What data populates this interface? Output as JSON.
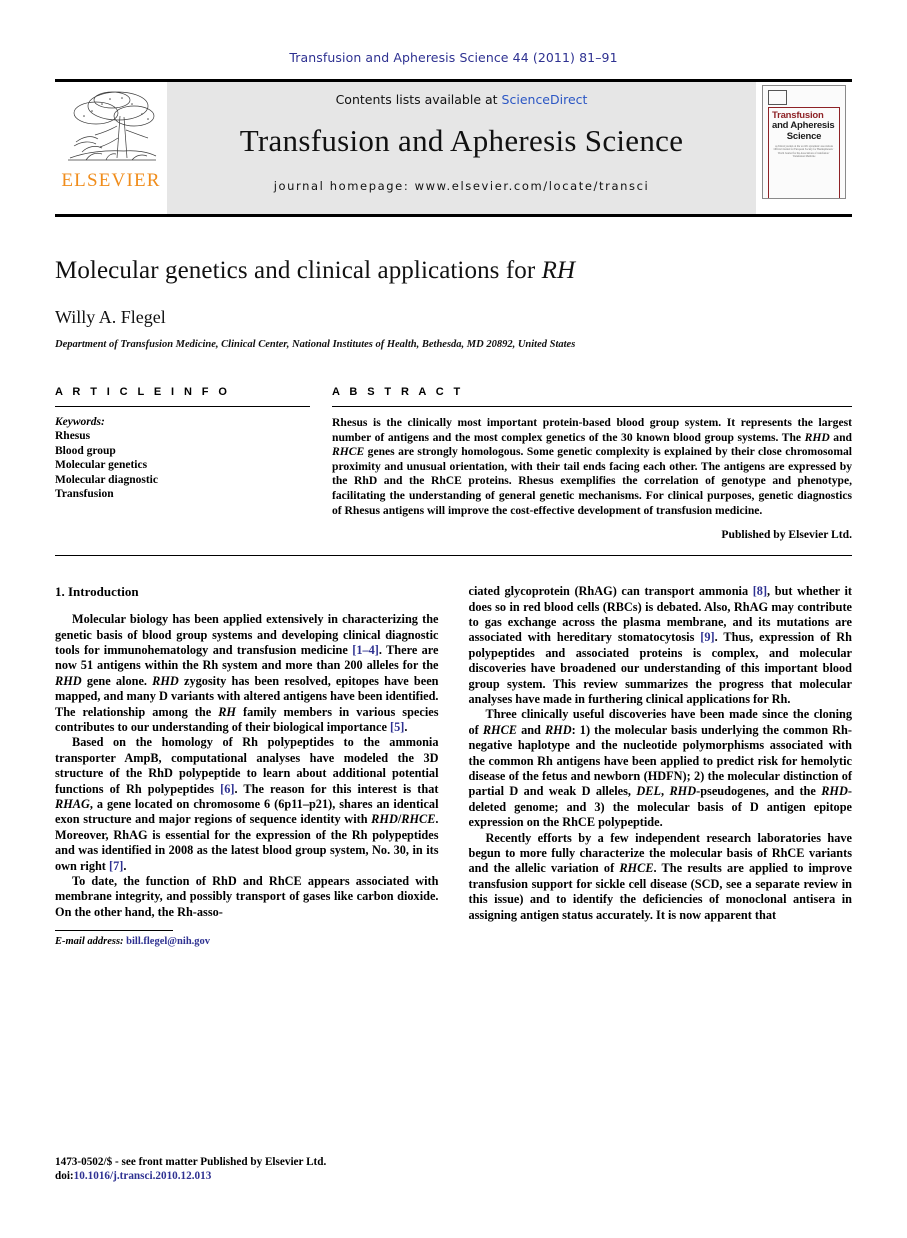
{
  "running_head": "Transfusion and Apheresis Science 44 (2011) 81–91",
  "masthead": {
    "publisher_wordmark": "ELSEVIER",
    "contents_prefix": "Contents lists available at ",
    "contents_link": "ScienceDirect",
    "journal_name": "Transfusion and Apheresis Science",
    "homepage_line": "journal homepage: www.elsevier.com/locate/transci",
    "cover": {
      "line1": "Transfusion",
      "line2": "and Apheresis",
      "line3": "Science",
      "blurb": "A clinical journal on the world's systematic associations Official Journal for European Society for Haemapheresis · World Journal for the Associations of transfusion · Transfusion Medicine"
    },
    "colors": {
      "elsevier_orange": "#f08d1c",
      "sciencedirect_blue": "#2b56c4",
      "cover_red": "#8e2226",
      "band_gray": "#e6e6e6"
    }
  },
  "article": {
    "title_main": "Molecular genetics and clinical applications for ",
    "title_italic": "RH",
    "author": "Willy A. Flegel",
    "affiliation": "Department of Transfusion Medicine, Clinical Center, National Institutes of Health, Bethesda, MD 20892, United States"
  },
  "article_info": {
    "heading": "A R T I C L E    I N F O",
    "keywords_label": "Keywords:",
    "keywords": [
      "Rhesus",
      "Blood group",
      "Molecular genetics",
      "Molecular diagnostic",
      "Transfusion"
    ]
  },
  "abstract": {
    "heading": "A B S T R A C T",
    "p1_a": "Rhesus is the clinically most important protein-based blood group system. It represents the largest number of antigens and the most complex genetics of the 30 known blood group systems. The ",
    "gene1": "RHD",
    "p1_b": " and ",
    "gene2": "RHCE",
    "p1_c": " genes are strongly homologous. Some genetic complexity is explained by their close chromosomal proximity and unusual orientation, with their tail ends facing each other. The antigens are expressed by the RhD and the RhCE proteins. Rhesus exemplifies the correlation of genotype and phenotype, facilitating the understanding of general genetic mechanisms. For clinical purposes, genetic diagnostics of Rhesus antigens will improve the cost-effective development of transfusion medicine.",
    "publisher_statement": "Published by Elsevier Ltd."
  },
  "body": {
    "section_heading": "1. Introduction",
    "left": {
      "p1_a": "Molecular biology has been applied extensively in characterizing the genetic basis of blood group systems and developing clinical diagnostic tools for immunohematology and transfusion medicine ",
      "p1_ref1": "[1–4]",
      "p1_b": ". There are now 51 antigens within the Rh system and more than 200 alleles for the ",
      "p1_gene1": "RHD",
      "p1_c": " gene alone. ",
      "p1_gene2": "RHD",
      "p1_d": " zygosity has been resolved, epitopes have been mapped, and many D variants with altered antigens have been identified. The relationship among the ",
      "p1_gene3": "RH",
      "p1_e": " family members in various species contributes to our understanding of their biological importance ",
      "p1_ref2": "[5]",
      "p1_f": ".",
      "p2_a": "Based on the homology of Rh polypeptides to the ammonia transporter AmpB, computational analyses have modeled the 3D structure of the RhD polypeptide to learn about additional potential functions of Rh polypeptides ",
      "p2_ref1": "[6]",
      "p2_b": ". The reason for this interest is that ",
      "p2_gene1": "RHAG",
      "p2_c": ", a gene located on chromosome 6 (6p11–p21), shares an identical exon structure and major regions of sequence identity with ",
      "p2_gene2": "RHD",
      "p2_d": "/",
      "p2_gene3": "RHCE",
      "p2_e": ". Moreover, RhAG is essential for the expression of the Rh polypeptides and was identified in 2008 as the latest blood group system, No. 30, in its own right ",
      "p2_ref2": "[7]",
      "p2_f": ".",
      "p3_a": "To date, the function of RhD and RhCE appears associated with membrane integrity, and possibly transport of gases like carbon dioxide. On the other hand, the Rh-asso-"
    },
    "right": {
      "p1_a": "ciated glycoprotein (RhAG) can transport ammonia ",
      "p1_ref1": "[8]",
      "p1_b": ", but whether it does so in red blood cells (RBCs) is debated. Also, RhAG may contribute to gas exchange across the plasma membrane, and its mutations are associated with hereditary stomatocytosis ",
      "p1_ref2": "[9]",
      "p1_c": ". Thus, expression of Rh polypeptides and associated proteins is complex, and molecular discoveries have broadened our understanding of this important blood group system. This review summarizes the progress that molecular analyses have made in furthering clinical applications for Rh.",
      "p2_a": "Three clinically useful discoveries have been made since the cloning of ",
      "p2_gene1": "RHCE",
      "p2_b": " and ",
      "p2_gene2": "RHD",
      "p2_c": ": 1) the molecular basis underlying the common Rh-negative haplotype and the nucleotide polymorphisms associated with the common Rh antigens have been applied to predict risk for hemolytic disease of the fetus and newborn (HDFN); 2) the molecular distinction of partial D and weak D alleles, ",
      "p2_gene3": "DEL",
      "p2_d": ", ",
      "p2_gene4": "RHD",
      "p2_e": "-pseudogenes, and the ",
      "p2_gene5": "RHD",
      "p2_f": "-deleted genome; and 3) the molecular basis of D antigen epitope expression on the RhCE polypeptide.",
      "p3_a": "Recently efforts by a few independent research laboratories have begun to more fully characterize the molecular basis of RhCE variants and the allelic variation of ",
      "p3_gene1": "RHCE",
      "p3_b": ". The results are applied to improve transfusion support for sickle cell disease (SCD, see a separate review in this issue) and to identify the deficiencies of monoclonal antisera in assigning antigen status accurately. It is now apparent that"
    }
  },
  "footnote": {
    "label": "E-mail address:",
    "email": "bill.flegel@nih.gov"
  },
  "footer": {
    "issn_line": "1473-0502/$ - see front matter Published by Elsevier Ltd.",
    "doi_prefix": "doi:",
    "doi_value": "10.1016/j.transci.2010.12.013"
  }
}
